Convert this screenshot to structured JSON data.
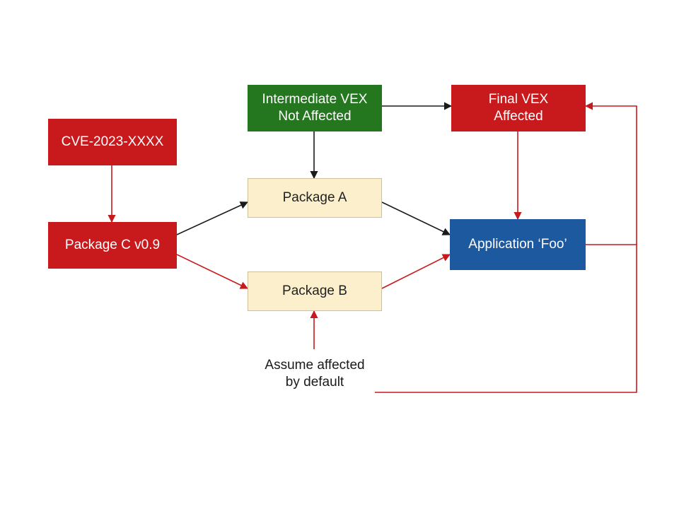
{
  "nodes": {
    "cve": {
      "text": "CVE-2023-XXXX"
    },
    "pkgC": {
      "text": "Package C v0.9"
    },
    "intVex": {
      "line1": "Intermediate VEX",
      "line2": "Not Affected"
    },
    "finalVex": {
      "line1": "Final VEX",
      "line2": "Affected"
    },
    "pkgA": {
      "text": "Package A"
    },
    "pkgB": {
      "text": "Package B"
    },
    "app": {
      "text": "Application ‘Foo’"
    }
  },
  "labels": {
    "assume": "Assume affected\nby default"
  },
  "colors": {
    "red": "#c8191d",
    "green": "#24771f",
    "cream": "#fcf0cc",
    "blue": "#1d599f",
    "black": "#1a1a1a"
  }
}
